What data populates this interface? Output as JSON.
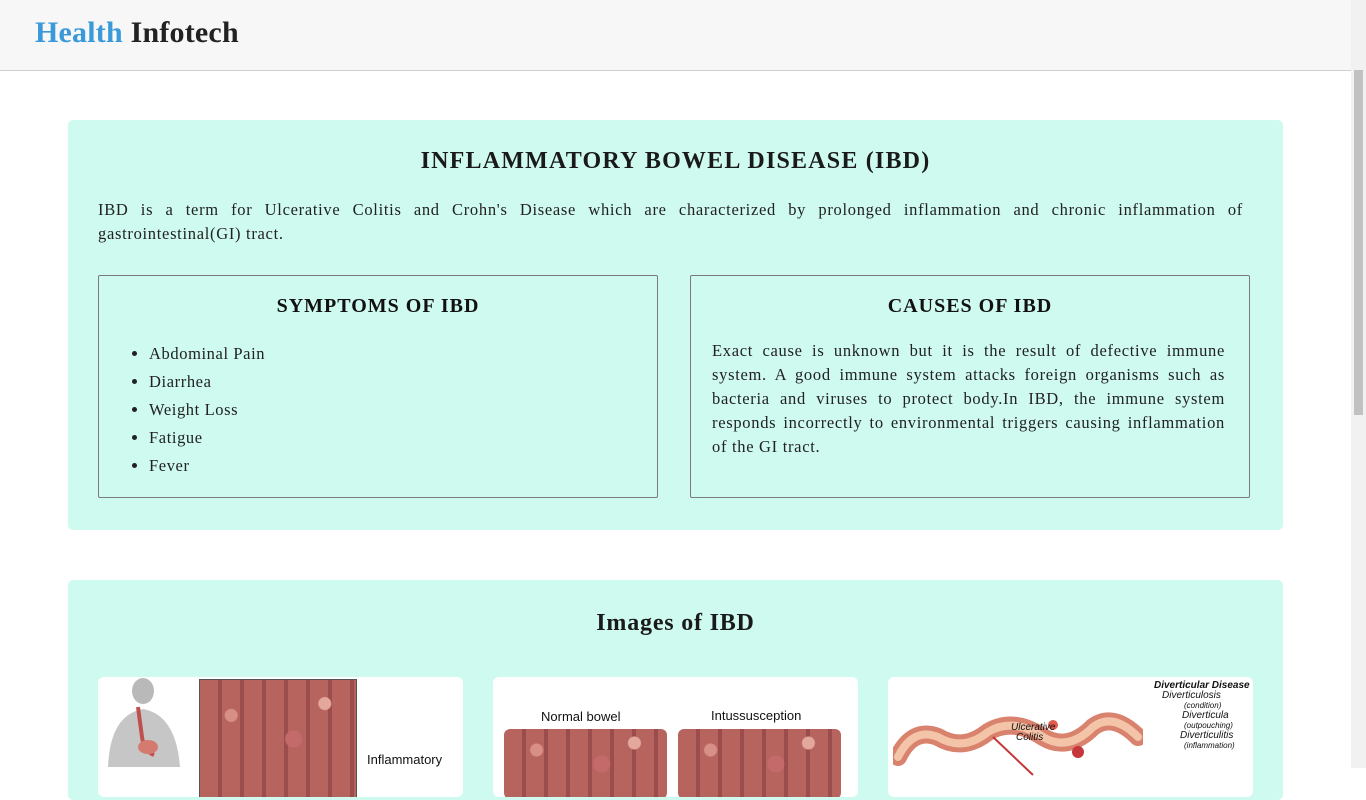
{
  "brand": {
    "part1": "Health",
    "part2": "Infotech"
  },
  "main": {
    "title": "INFLAMMATORY BOWEL DISEASE (IBD)",
    "intro": "IBD is a term for Ulcerative Colitis and Crohn's Disease which are characterized by prolonged inflammation and chronic inflammation of gastrointestinal(GI) tract."
  },
  "symptoms": {
    "heading": "SYMPTOMS OF IBD",
    "items": [
      "Abdominal Pain",
      "Diarrhea",
      "Weight Loss",
      "Fatigue",
      "Fever"
    ]
  },
  "causes": {
    "heading": "CAUSES OF IBD",
    "text": "Exact cause is unknown but it is the result of defective immune system. A good immune system attacks foreign organisms such as bacteria and viruses to protect body.In IBD, the immune system responds incorrectly to environmental triggers causing inflammation of the GI tract."
  },
  "images": {
    "title": "Images of IBD",
    "card1_label": "Inflammatory",
    "card2_labels": [
      "Normal bowel",
      "Intussusception"
    ],
    "card3_labels": [
      "Diverticular Disease",
      "Diverticulosis",
      "(condition)",
      "Diverticula",
      "(outpouching)",
      "Diverticulitis",
      "(inflammation)",
      "Ulcerative",
      "Colitis"
    ]
  }
}
